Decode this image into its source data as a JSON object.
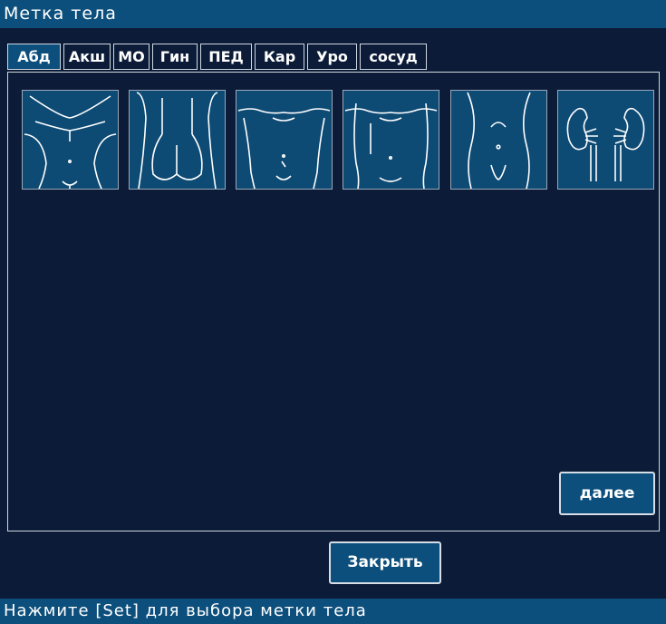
{
  "window": {
    "title": "Метка тела"
  },
  "tabs": [
    {
      "label": "Абд",
      "active": true
    },
    {
      "label": "Акш",
      "active": false
    },
    {
      "label": "МО",
      "active": false
    },
    {
      "label": "Гин",
      "active": false
    },
    {
      "label": "ПЕД",
      "active": false
    },
    {
      "label": "Кар",
      "active": false
    },
    {
      "label": "Уро",
      "active": false
    },
    {
      "label": "сосуд",
      "active": false
    }
  ],
  "body_marks": [
    {
      "icon": "abdomen-front-icon"
    },
    {
      "icon": "back-buttocks-icon"
    },
    {
      "icon": "torso-front-icon"
    },
    {
      "icon": "torso-front-alt-icon"
    },
    {
      "icon": "waist-front-icon"
    },
    {
      "icon": "kidneys-icon"
    }
  ],
  "buttons": {
    "next_label": "далее",
    "close_label": "Закрыть"
  },
  "status": {
    "text": "Нажмите [Set] для выбора метки тела"
  },
  "colors": {
    "background": "#0c1c38",
    "accent": "#0c4f7c",
    "border": "#cfd6df"
  }
}
